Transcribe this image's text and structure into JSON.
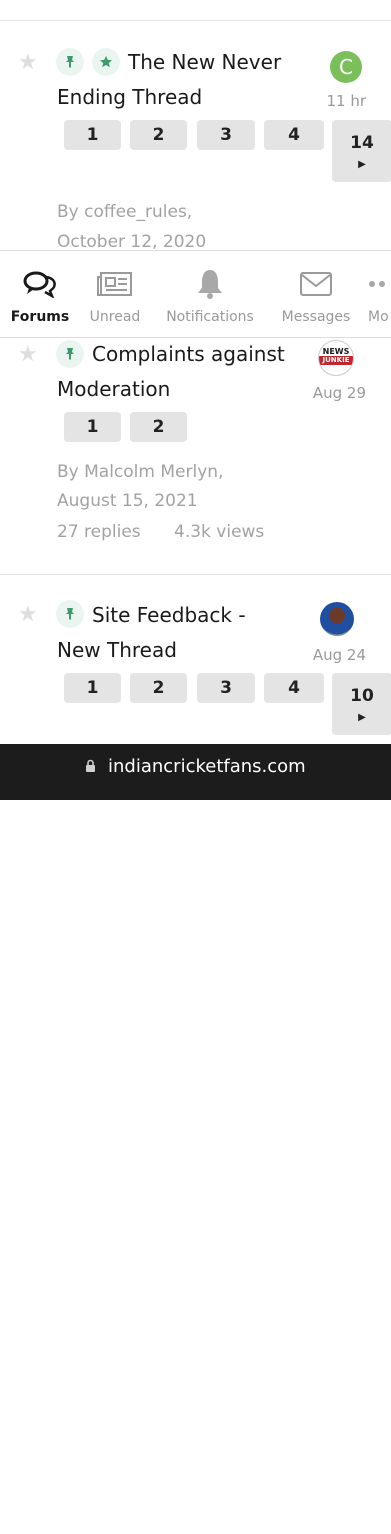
{
  "threads": [
    {
      "title_line1": "The New Never",
      "title_line2": "Ending Thread",
      "avatar_letter": "C",
      "avatar_color": "#7bbf5a",
      "date": "11 hr",
      "pages": [
        "1",
        "2",
        "3",
        "4",
        "14"
      ],
      "author_line": "By coffee_rules,",
      "date_line": "October 12, 2020"
    },
    {
      "title_line1": "Complaints against",
      "title_line2": "Moderation",
      "avatar_label_top": "NEWS",
      "avatar_label_bottom": "JUNKIE",
      "date": "Aug 29",
      "pages": [
        "1",
        "2"
      ],
      "author_line": "By Malcolm Merlyn,",
      "date_line": "August 15, 2021",
      "replies": "27 replies",
      "views": "4.3k views"
    },
    {
      "title_line1": "Site Feedback -",
      "title_line2": "New Thread",
      "date": "Aug 24",
      "pages": [
        "1",
        "2",
        "3",
        "4",
        "10"
      ]
    }
  ],
  "nav": {
    "forums": "Forums",
    "unread": "Unread",
    "notifications": "Notifications",
    "messages": "Messages",
    "more": "Mo"
  },
  "browser": {
    "url": "indiancricketfans.com"
  },
  "colors": {
    "pin_green": "#3d9a6a",
    "accent_green": "#7bbf5a"
  }
}
